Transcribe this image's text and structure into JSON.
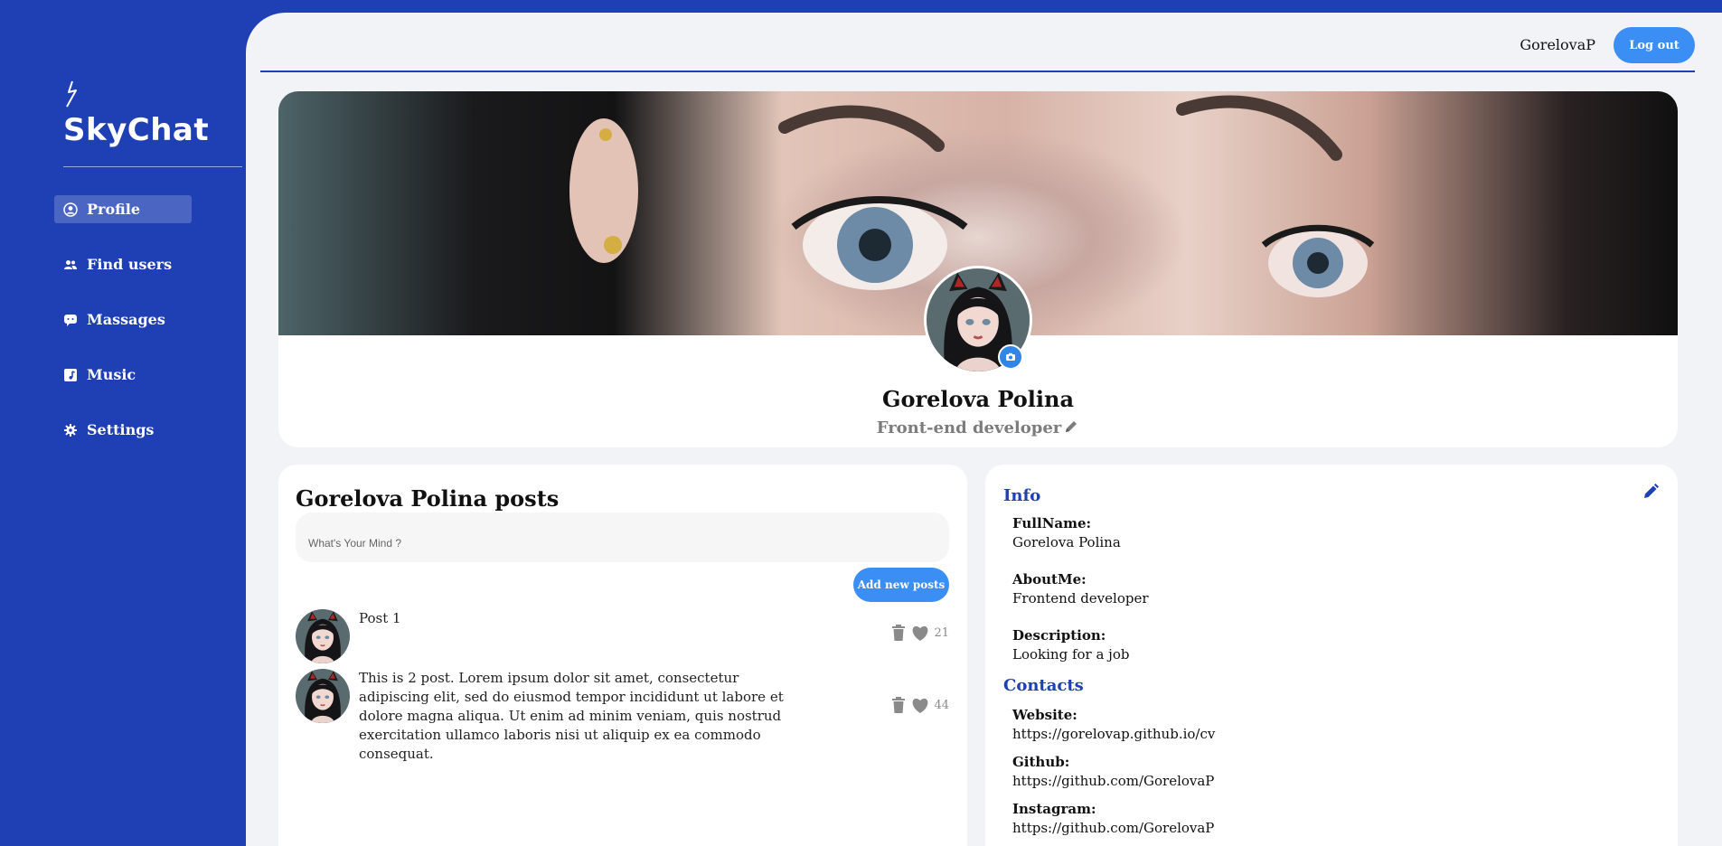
{
  "app": {
    "name": "SkyChat"
  },
  "sidebar": {
    "items": [
      {
        "label": "Profile",
        "icon": "user-circle-icon",
        "active": true
      },
      {
        "label": "Find users",
        "icon": "users-icon",
        "active": false
      },
      {
        "label": "Massages",
        "icon": "chat-icon",
        "active": false
      },
      {
        "label": "Music",
        "icon": "music-icon",
        "active": false
      },
      {
        "label": "Settings",
        "icon": "gear-icon",
        "active": false
      }
    ]
  },
  "header": {
    "username": "GorelovaP",
    "logout_label": "Log out"
  },
  "profile": {
    "name": "Gorelova Polina",
    "role": "Front-end developer"
  },
  "posts": {
    "title": "Gorelova Polina posts",
    "input_placeholder": "What's Your Mind ?",
    "add_label": "Add new posts",
    "items": [
      {
        "text": "Post 1",
        "likes": "21"
      },
      {
        "text": "This is 2 post. Lorem ipsum dolor sit amet, consectetur adipiscing elit, sed do eiusmod tempor incididunt ut labore et dolore magna aliqua. Ut enim ad minim veniam, quis nostrud exercitation ullamco laboris nisi ut aliquip ex ea commodo consequat.",
        "likes": "44"
      }
    ]
  },
  "info": {
    "title": "Info",
    "fields": [
      {
        "label": "FullName:",
        "value": "Gorelova Polina"
      },
      {
        "label": "AboutMe:",
        "value": "Frontend developer"
      },
      {
        "label": "Description:",
        "value": "Looking for a job"
      }
    ],
    "contacts_title": "Contacts",
    "contacts": [
      {
        "label": "Website:",
        "value": "https://gorelovap.github.io/cv"
      },
      {
        "label": "Github:",
        "value": "https://github.com/GorelovaP"
      },
      {
        "label": "Instagram:",
        "value": "https://github.com/GorelovaP"
      }
    ]
  },
  "colors": {
    "sidebar": "#1f3fb4",
    "accent": "#3b8ef4",
    "background": "#f1f3f7"
  }
}
